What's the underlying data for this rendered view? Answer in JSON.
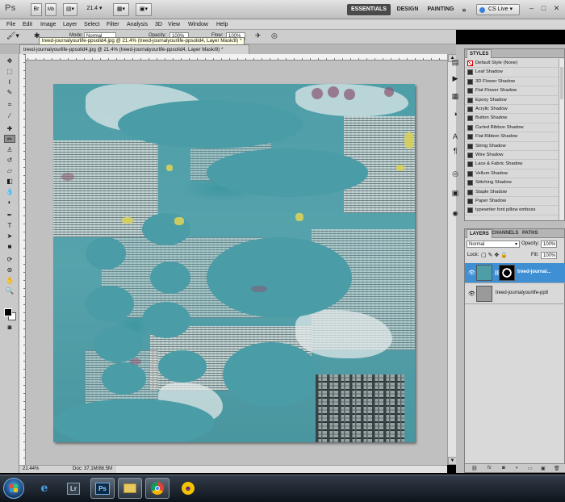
{
  "app_bar": {
    "logo": "Ps",
    "zoom_value": "21.4",
    "workspaces": [
      {
        "label": "ESSENTIALS",
        "active": true
      },
      {
        "label": "DESIGN",
        "active": false
      },
      {
        "label": "PAINTING",
        "active": false
      }
    ],
    "more_label": "»",
    "cs_live_label": "CS Live",
    "window_controls": [
      "–",
      "□",
      "✕"
    ]
  },
  "menu": [
    "File",
    "Edit",
    "Image",
    "Layer",
    "Select",
    "Filter",
    "Analysis",
    "3D",
    "View",
    "Window",
    "Help"
  ],
  "options_bar": {
    "mode_label": "Mode:",
    "mode_value": "Normal",
    "opacity_label": "Opacity:",
    "opacity_value": "100%",
    "flow_label": "Flow:",
    "flow_value": "100%"
  },
  "document": {
    "tab_title": "treed-journalyourlife-ppsolid4.jpg @ 21.4% (treed-journalyourlife-ppsolid4, Layer Mask/8) *",
    "tooltip": "treed-journalyourlife-ppsolid4.jpg @ 21.4% (treed-journalyourlife-ppsolid4, Layer Mask/8) *",
    "zoom": "21.44%",
    "doc_size": "Doc: 37.1M/86.5M"
  },
  "styles_panel": {
    "tab": "STYLES",
    "items": [
      "Default Style (None)",
      "Leaf Shadow",
      "3D Flower Shadow",
      "Flat Flower Shadow",
      "Epoxy Shadow",
      "Acrylic Shadow",
      "Button Shadow",
      "Curled Ribbon Shadow",
      "Flat Ribbon Shadow",
      "String Shadow",
      "Wire Shadow",
      "Lace & Fabric Shadow",
      "Vellum Shadow",
      "Stitching Shadow",
      "Staple Shadow",
      "Paper Shadow",
      "typewriter font pillow emboss"
    ]
  },
  "layers_panel": {
    "tabs": [
      {
        "label": "LAYERS",
        "active": true
      },
      {
        "label": "CHANNELS",
        "active": false
      },
      {
        "label": "PATHS",
        "active": false
      }
    ],
    "blend_mode": "Normal",
    "opacity_label": "Opacity:",
    "opacity_value": "100%",
    "lock_label": "Lock:",
    "fill_label": "Fill:",
    "fill_value": "100%",
    "layers": [
      {
        "name": "treed-journal...",
        "selected": true,
        "visible": true
      },
      {
        "name": "treed-journalyourlife-pp8",
        "selected": false,
        "visible": true
      }
    ]
  },
  "taskbar": {
    "items": [
      {
        "icon": "ie-icon",
        "open": false
      },
      {
        "icon": "lightroom-icon",
        "label": "Lr",
        "open": false
      },
      {
        "icon": "photoshop-icon",
        "label": "Ps",
        "open": true
      },
      {
        "icon": "folder-icon",
        "open": true
      },
      {
        "icon": "chrome-icon",
        "open": true
      },
      {
        "icon": "yahoo-messenger-icon",
        "open": false
      }
    ]
  },
  "colors": {
    "accent_selection": "#3e8fd4",
    "canvas_teal": "#4e9ea8",
    "workspace_gray": "#c0c0c0"
  }
}
